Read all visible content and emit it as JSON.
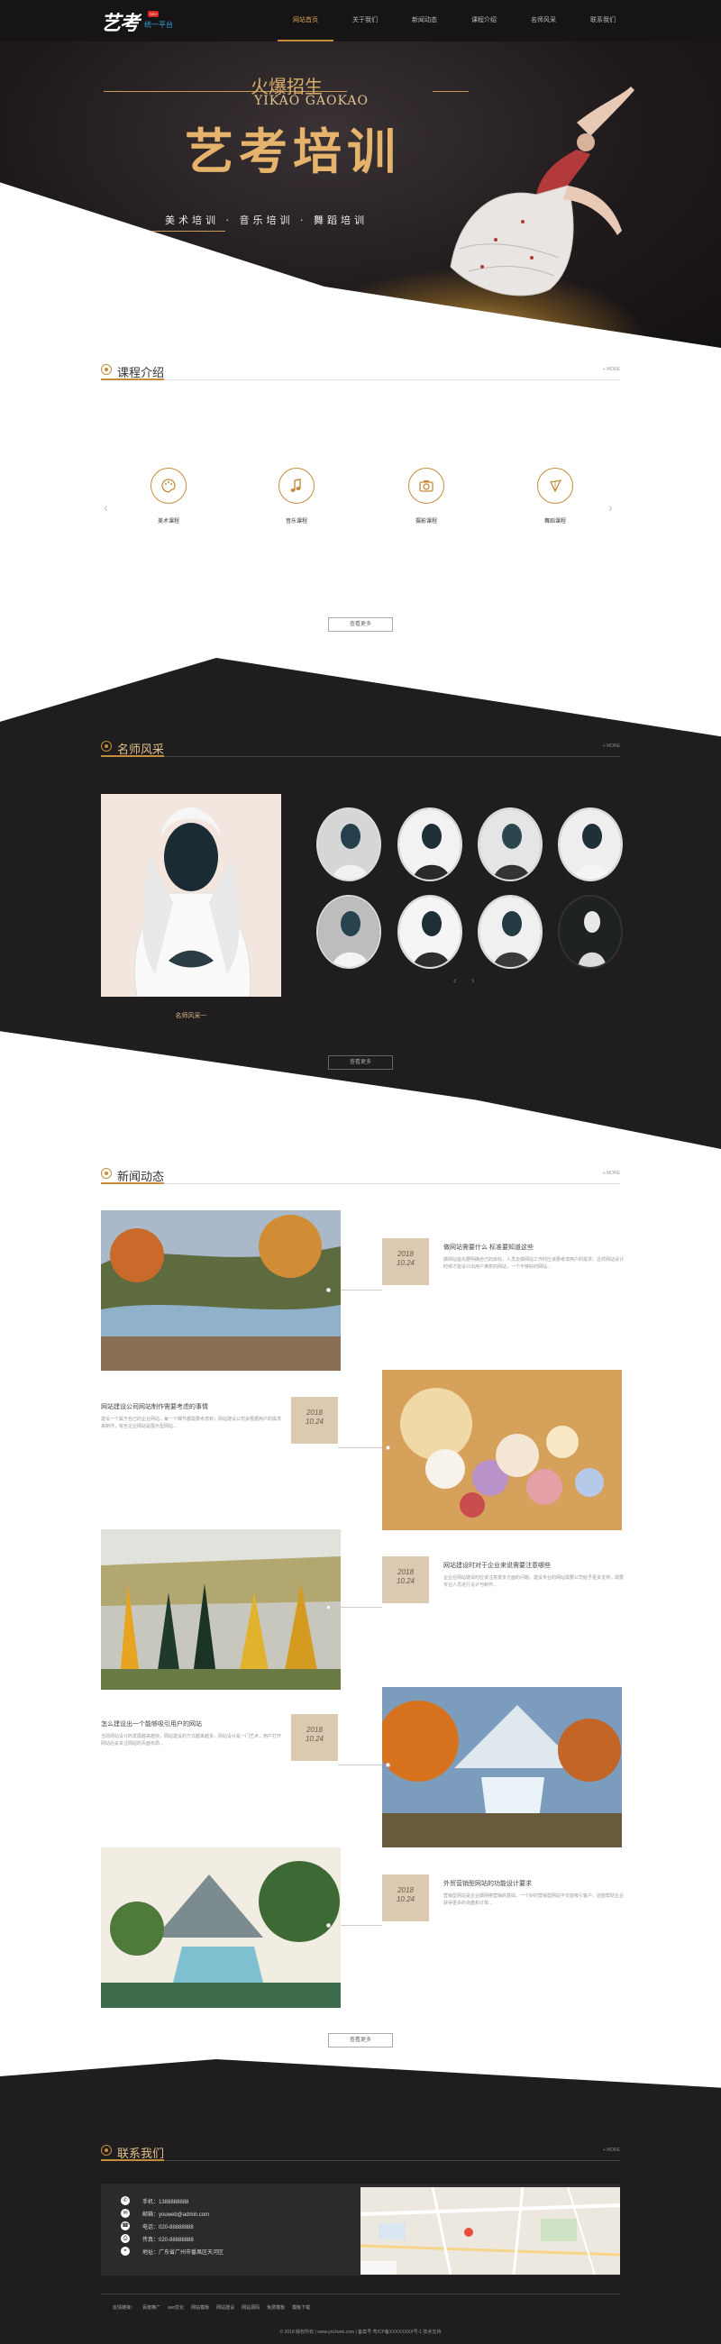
{
  "header": {
    "logo": "艺考",
    "logo_badge": "SEO",
    "logo_sub": "统一平台",
    "nav": [
      "网站首页",
      "关于我们",
      "新闻动态",
      "课程介绍",
      "名师风采",
      "联系我们"
    ]
  },
  "hero": {
    "line1": "火爆招生",
    "line2": "YIKAO GAOKAO",
    "title": "艺考培训",
    "subtitle": "美术培训 · 音乐培训 · 舞蹈培训"
  },
  "courses": {
    "title": "课程介绍",
    "more": "+ MORE",
    "items": [
      {
        "label": "美术课程",
        "icon": "palette-icon"
      },
      {
        "label": "音乐课程",
        "icon": "music-note-icon"
      },
      {
        "label": "摄影课程",
        "icon": "camera-icon"
      },
      {
        "label": "舞蹈课程",
        "icon": "fan-icon"
      }
    ],
    "button": "查看更多"
  },
  "teachers": {
    "title": "名师风采",
    "more": "+ MORE",
    "caption": "名师风采一",
    "pager": [
      "‹",
      "›"
    ],
    "button": "查看更多"
  },
  "news": {
    "title": "新闻动态",
    "more": "+ MORE",
    "items": [
      {
        "year": "2018",
        "day": "10.24",
        "title": "做网站需要什么 标准要知道这些",
        "desc": "做网站首先要明确自己的目标，人员去做网站工作时应该要考虑用户的需求，这样网站设计时候才能设计出用户满意的网站，一个不够好的网站..."
      },
      {
        "year": "2018",
        "day": "10.24",
        "title": "网站建设公司网站制作需要考虑的事情",
        "desc": "建设一个属于自己的企业网站，每一个细节都需要考虑到，网站建设公司会根据用户的需求来制作，有些企业网站是展示型网站..."
      },
      {
        "year": "2018",
        "day": "10.24",
        "title": "网站建设时对于企业来说需要注意哪些",
        "desc": "企业在网站建设时应该注意很多方面的问题，建设专业的网站需要公司给予更多支持，需要专业人员进行设计与制作..."
      },
      {
        "year": "2018",
        "day": "10.24",
        "title": "怎么建设出一个能够吸引用户的网站",
        "desc": "当前网站设计的发展越来越快，网站建设的方式越来越多，网站设计是一门艺术，用户打开网站后会关注网站的页面布局..."
      },
      {
        "year": "2018",
        "day": "10.24",
        "title": "外贸营销型网站的功能设计要求",
        "desc": "营销型网站是企业做网络营销的基础，一个好的营销型网站不仅能吸引客户，还能帮助企业获得更多的询盘和订单..."
      }
    ],
    "button": "查看更多"
  },
  "contact": {
    "title": "联系我们",
    "more": "+ MORE",
    "rows": [
      {
        "icon": "phone-icon",
        "text": "手机：1388888888"
      },
      {
        "icon": "email-icon",
        "text": "邮箱：youweb@admin.com"
      },
      {
        "icon": "telephone-icon",
        "text": "电话：020-88888888"
      },
      {
        "icon": "fax-icon",
        "text": "传真：020-88888888"
      },
      {
        "icon": "location-icon",
        "text": "地址：广东省广州市番禺区天河区"
      }
    ]
  },
  "footer": {
    "links": [
      "友情链接：",
      "百度推广",
      "seo优化",
      "网站模板",
      "网站建设",
      "网站源码",
      "免费模板",
      "模板下载"
    ],
    "copyright": "© 2018 版权所有 | www.yoUweb.com | 备案号 粤ICP备XXXXXXXX号-1 技术支持"
  },
  "colors": {
    "accent": "#c58c3c",
    "dark_bg": "#1f1d1e",
    "header_bg": "#161414"
  }
}
